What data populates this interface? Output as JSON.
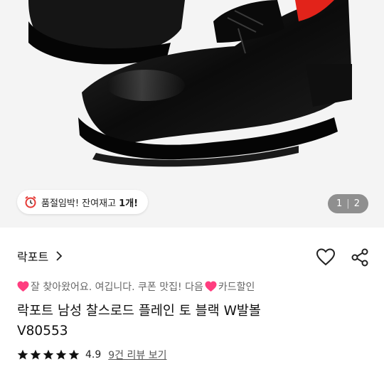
{
  "hero": {
    "image_label": "black leather plain toe derby shoe",
    "stock_badge": {
      "text": "품절임박! 잔여재고 ",
      "emphasis": "1개!"
    },
    "pager": {
      "current": "1",
      "total": "2"
    }
  },
  "product": {
    "brand": "락포트",
    "promo_text_1": "잘 찾아왔어요. 여깁니다. 쿠폰 맛집! 다음",
    "promo_text_2": "카드할인",
    "title": "락포트 남성 찰스로드 플레인 토 블랙 W발볼 V80553",
    "rating": {
      "stars": 5,
      "score": "4.9",
      "reviews": "9건 리뷰 보기"
    }
  },
  "colors": {
    "heart_emoji": "#ff3d7f",
    "star": "#111111"
  }
}
